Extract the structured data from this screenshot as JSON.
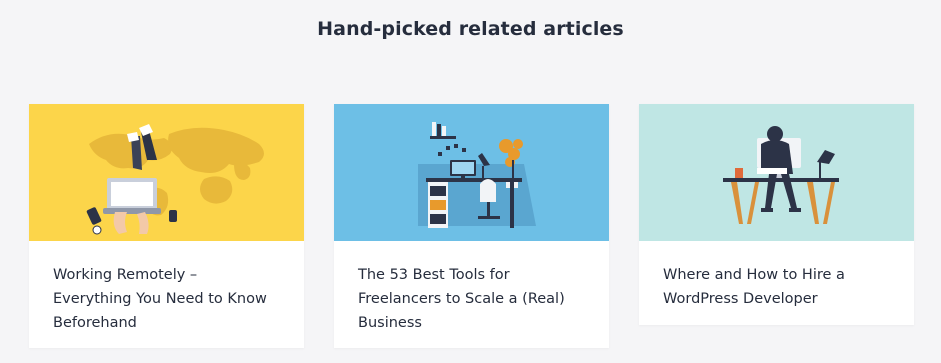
{
  "section": {
    "title": "Hand-picked related articles"
  },
  "articles": [
    {
      "title": "Working Remotely – Everything You Need to Know Beforehand",
      "thumb_bg": "#fcd54a",
      "illustration": "remote-work-laptop-world-map-illustration"
    },
    {
      "title": "The 53 Best Tools for Freelancers to Scale a (Real) Business",
      "thumb_bg": "#6dbfe6",
      "illustration": "freelancer-desk-workspace-illustration"
    },
    {
      "title": "Where and How to Hire a WordPress Developer",
      "thumb_bg": "#bfe6e4",
      "illustration": "wordpress-developer-at-desk-illustration"
    }
  ]
}
